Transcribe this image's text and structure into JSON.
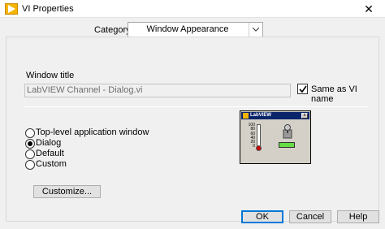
{
  "window": {
    "title": "VI Properties",
    "close_glyph": "✕",
    "icon": "labview-icon"
  },
  "category": {
    "label": "Category",
    "value": "Window Appearance"
  },
  "window_title": {
    "label": "Window title",
    "value": "LabVIEW Channel - Dialog.vi",
    "same_as_vi_label": "Same as VI name",
    "same_as_vi_checked": true
  },
  "appearance_options": [
    {
      "label": "Top-level application window",
      "checked": false
    },
    {
      "label": "Dialog",
      "checked": true
    },
    {
      "label": "Default",
      "checked": false
    },
    {
      "label": "Custom",
      "checked": false
    }
  ],
  "customize_label": "Customize...",
  "preview": {
    "title": "LabVIEW",
    "scale": [
      "100",
      "80",
      "60",
      "40",
      "20",
      "0"
    ]
  },
  "buttons": {
    "ok": "OK",
    "cancel": "Cancel",
    "help": "Help"
  },
  "colors": {
    "dialog_bg": "#f0f0f0",
    "default_button_border": "#0078d7",
    "preview_titlebar": "#0a246a"
  }
}
